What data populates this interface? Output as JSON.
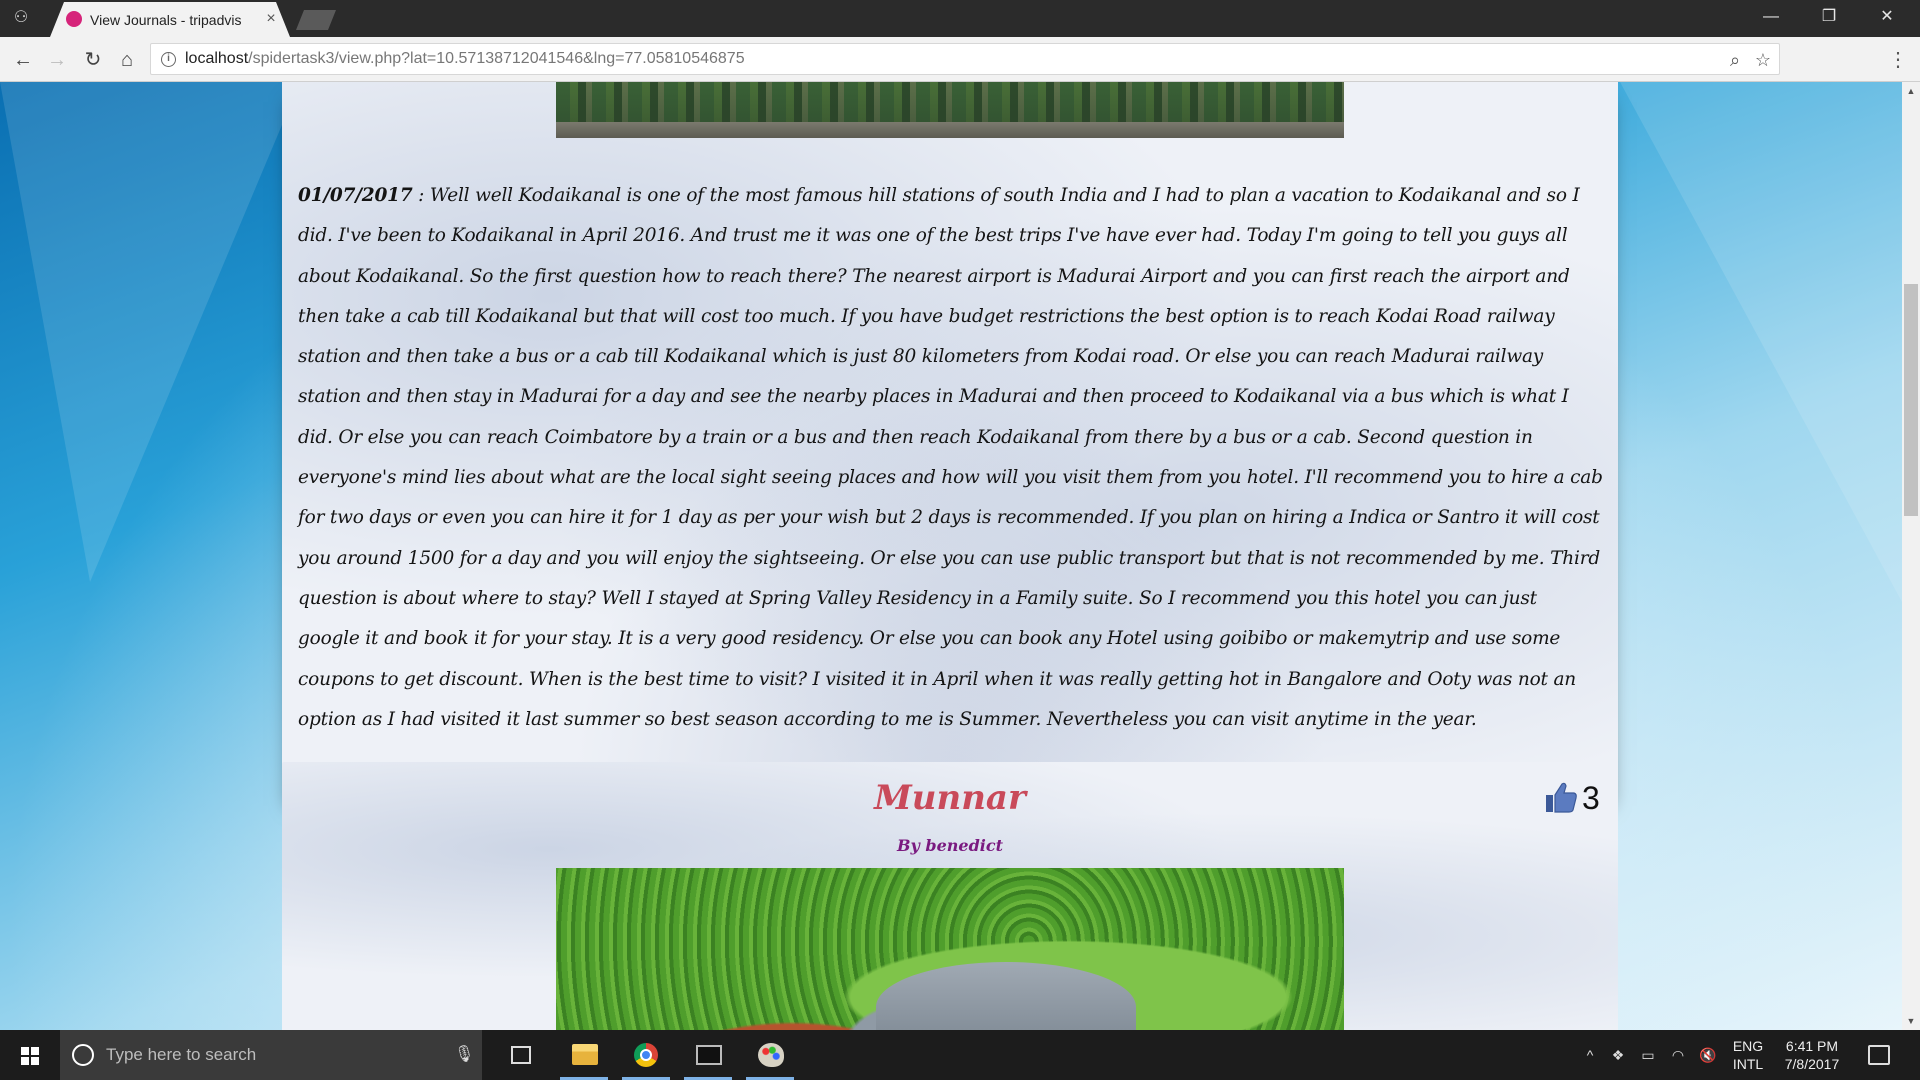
{
  "browser": {
    "tab_title": "View Journals - tripadvis",
    "tab_close": "×",
    "url_host": "localhost",
    "url_path": "/spidertask3/view.php?lat=10.57138712041546&lng=77.05810546875",
    "window_controls": [
      "—",
      "❐",
      "✕"
    ],
    "nav": {
      "back": "←",
      "forward": "→",
      "reload": "↻",
      "home": "⌂"
    }
  },
  "entry1": {
    "date": "01/07/2017",
    "text": " : Well well Kodaikanal is one of the most famous hill stations of south India and I had to plan a vacation to Kodaikanal and so I did. I've been to Kodaikanal in April 2016. And trust me it was one of the best trips I've have ever had. Today I'm going to tell you guys all about Kodaikanal. So the first question how to reach there? The nearest airport is Madurai Airport and you can first reach the airport and then take a cab till Kodaikanal but that will cost too much. If you have budget restrictions the best option is to reach Kodai Road railway station and then take a bus or a cab till Kodaikanal which is just 80 kilometers from Kodai road. Or else you can reach Madurai railway station and then stay in Madurai for a day and see the nearby places in Madurai and then proceed to Kodaikanal via a bus which is what I did. Or else you can reach Coimbatore by a train or a bus and then reach Kodaikanal from there by a bus or a cab. Second question in everyone's mind lies about what are the local sight seeing places and how will you visit them from you hotel. I'll recommend you to hire a cab for two days or even you can hire it for 1 day as per your wish but 2 days is recommended. If you plan on hiring a Indica or Santro it will cost you around 1500 for a day and you will enjoy the sightseeing. Or else you can use public transport but that is not recommended by me. Third question is about where to stay? Well I stayed at Spring Valley Residency in a Family suite. So I recommend you this hotel you can just google it and book it for your stay. It is a very good residency. Or else you can book any Hotel using goibibo or makemytrip and use some coupons to get discount. When is the best time to visit? I visited it in April when it was really getting hot in Bangalore and Ooty was not an option as I had visited it last summer so best season according to me is Summer. Nevertheless you can visit anytime in the year."
  },
  "entry2": {
    "title": "Munnar",
    "author": "By benedict",
    "likes": "3"
  },
  "taskbar": {
    "search_placeholder": "Type here to search",
    "lang_line1": "ENG",
    "lang_line2": "INTL",
    "time": "6:41 PM",
    "date": "7/8/2017"
  },
  "colors": {
    "title": "#c94a5a",
    "author": "#7a1a80",
    "taskbar": "#1c1c1c",
    "accent": "#7eb2e6"
  }
}
